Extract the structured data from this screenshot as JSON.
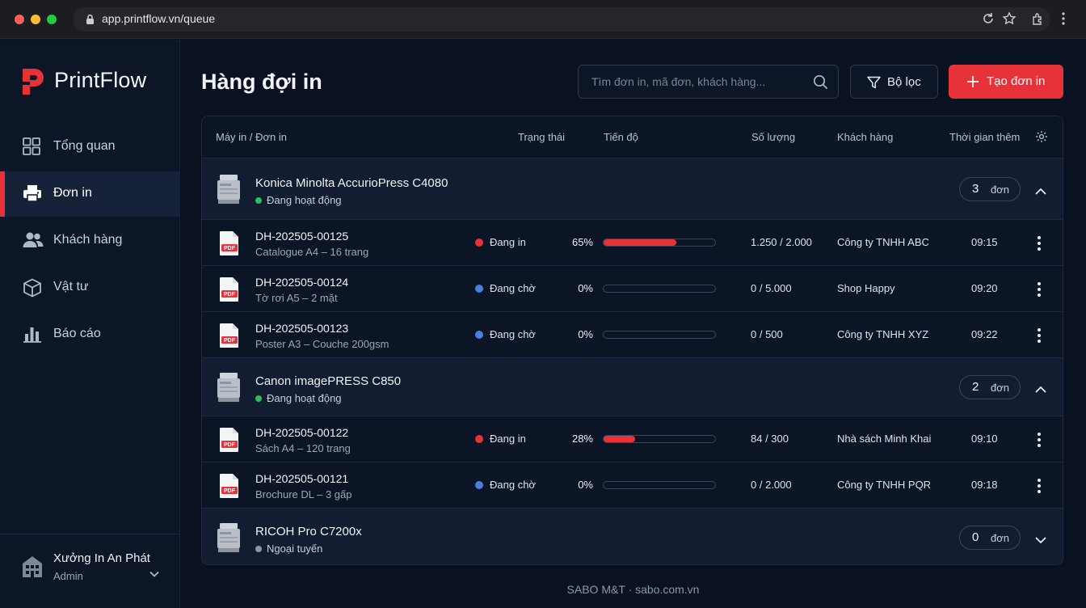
{
  "browser": {
    "url": "app.printflow.vn/queue"
  },
  "brand": {
    "name": "PrintFlow",
    "accent": "#e8323a"
  },
  "sidebar": {
    "items": [
      {
        "label": "Tổng quan",
        "icon": "grid-icon"
      },
      {
        "label": "Đơn in",
        "icon": "printer-icon",
        "active": true
      },
      {
        "label": "Khách hàng",
        "icon": "users-icon"
      },
      {
        "label": "Vật tư",
        "icon": "box-icon"
      },
      {
        "label": "Báo cáo",
        "icon": "bar-chart-icon"
      }
    ],
    "workspace": {
      "name": "Xưởng In An Phát",
      "role": "Admin"
    }
  },
  "header": {
    "title": "Hàng đợi in",
    "search_placeholder": "Tìm đơn in, mã đơn, khách hàng...",
    "filter_label": "Bộ lọc",
    "create_label": "Tạo đơn in"
  },
  "table": {
    "columns": [
      "Máy in / Đơn in",
      "Trạng thái",
      "Tiến độ",
      "Số lượng",
      "Khách hàng",
      "Thời gian thêm"
    ],
    "count_unit": "đơn",
    "groups": [
      {
        "printer": "Konica Minolta AccurioPress C4080",
        "status": "Đang hoạt động",
        "status_color": "#2fbf5a",
        "count": "3",
        "expanded": true,
        "orders": [
          {
            "id": "DH-202505-00125",
            "desc": "Catalogue A4 – 16 trang",
            "status": "Đang in",
            "status_color": "#e8323a",
            "progress_label": "65%",
            "progress": 65,
            "qty": "1.250 / 2.000",
            "customer": "Công ty TNHH ABC",
            "time": "09:15"
          },
          {
            "id": "DH-202505-00124",
            "desc": "Tờ rơi A5 – 2 mặt",
            "status": "Đang chờ",
            "status_color": "#4a7fe0",
            "progress_label": "0%",
            "progress": 0,
            "qty": "0 / 5.000",
            "customer": "Shop Happy",
            "time": "09:20"
          },
          {
            "id": "DH-202505-00123",
            "desc": "Poster A3 – Couche 200gsm",
            "status": "Đang chờ",
            "status_color": "#4a7fe0",
            "progress_label": "0%",
            "progress": 0,
            "qty": "0 / 500",
            "customer": "Công ty TNHH XYZ",
            "time": "09:22"
          }
        ]
      },
      {
        "printer": "Canon imagePRESS C850",
        "status": "Đang hoạt động",
        "status_color": "#2fbf5a",
        "count": "2",
        "expanded": true,
        "orders": [
          {
            "id": "DH-202505-00122",
            "desc": "Sách A4 – 120 trang",
            "status": "Đang in",
            "status_color": "#e8323a",
            "progress_label": "28%",
            "progress": 28,
            "qty": "84 / 300",
            "customer": "Nhà sách Minh Khai",
            "time": "09:10"
          },
          {
            "id": "DH-202505-00121",
            "desc": "Brochure DL – 3 gấp",
            "status": "Đang chờ",
            "status_color": "#4a7fe0",
            "progress_label": "0%",
            "progress": 0,
            "qty": "0 / 2.000",
            "customer": "Công ty TNHH PQR",
            "time": "09:18"
          }
        ]
      },
      {
        "printer": "RICOH Pro C7200x",
        "status": "Ngoại tuyến",
        "status_color": "#8d96a5",
        "count": "0",
        "expanded": false,
        "orders": []
      }
    ]
  },
  "footer": {
    "text": "SABO M&T · sabo.com.vn"
  }
}
